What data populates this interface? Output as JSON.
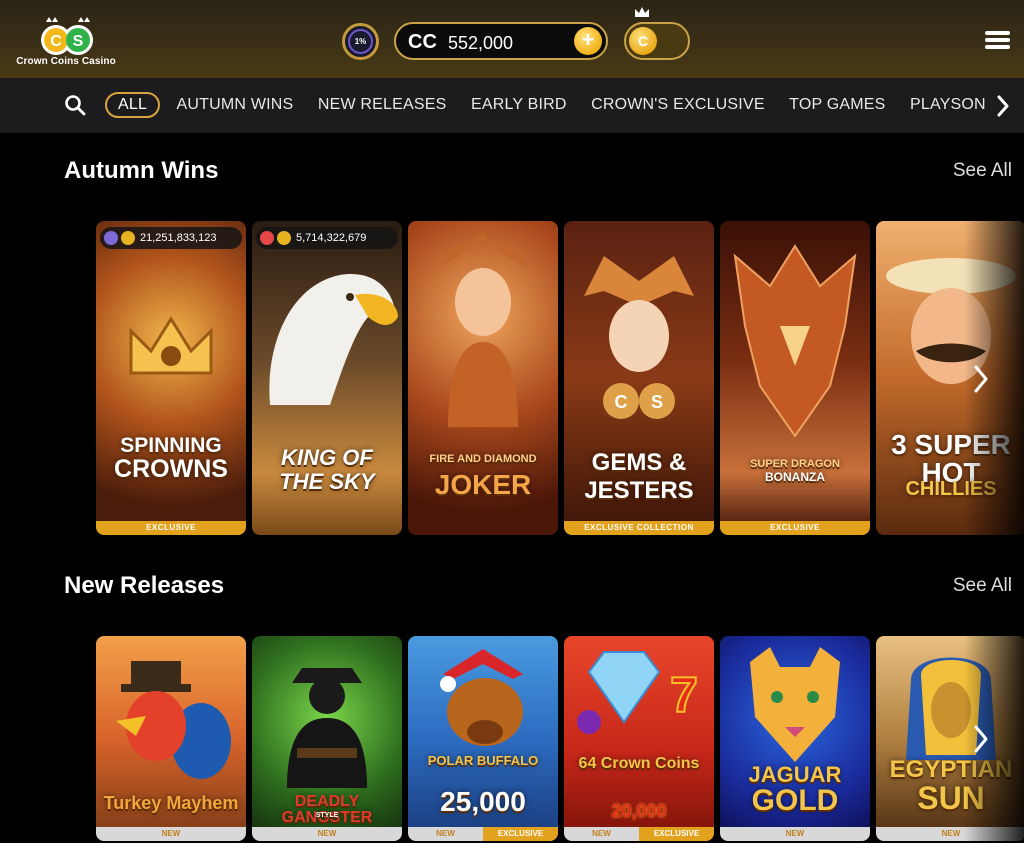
{
  "header": {
    "logo_text": "Crown Coins Casino",
    "vip_label": "1%",
    "balance_currency": "CC",
    "balance_amount": "552,000",
    "coin_letter": "C"
  },
  "nav": {
    "items": [
      "ALL",
      "AUTUMN WINS",
      "NEW RELEASES",
      "EARLY BIRD",
      "CROWN'S EXCLUSIVE",
      "TOP GAMES",
      "PLAYSON JACK"
    ]
  },
  "sections": [
    {
      "title": "Autumn Wins",
      "see_all": "See All",
      "tiles": [
        {
          "name_line1": "SPINNING",
          "name_line2": "CROWNS",
          "label": "EXCLUSIVE",
          "jackpot": "21,251,833,123"
        },
        {
          "name_line1": "KING OF",
          "name_line2": "THE SKY",
          "label": "",
          "jackpot": "5,714,322,679"
        },
        {
          "name_line1": "FIRE AND DIAMOND",
          "name_line2": "JOKER",
          "label": ""
        },
        {
          "name_line1": "GEMS &",
          "name_line2": "JESTERS",
          "label": "EXCLUSIVE COLLECTION"
        },
        {
          "name_line1": "SUPER DRAGON",
          "name_line2": "BONANZA",
          "label": "EXCLUSIVE"
        },
        {
          "name_line1": "3 SUPER HOT",
          "name_line2": "CHILLIES",
          "label": ""
        }
      ]
    },
    {
      "title": "New Releases",
      "see_all": "See All",
      "tiles": [
        {
          "name_line1": "Turkey Mayhem",
          "name_line2": "",
          "labels": [
            "NEW"
          ]
        },
        {
          "name_line1": "DEADLY GANGSTER",
          "name_line2": "STYLE",
          "labels": [
            "NEW"
          ]
        },
        {
          "name_line1": "POLAR BUFFALO",
          "name_line2": "25,000",
          "labels": [
            "NEW",
            "EXCLUSIVE"
          ]
        },
        {
          "name_line1": "64 Crown Coins",
          "name_line2": "20,000",
          "labels": [
            "NEW",
            "EXCLUSIVE"
          ]
        },
        {
          "name_line1": "JAGUAR",
          "name_line2": "GOLD",
          "labels": [
            "NEW"
          ]
        },
        {
          "name_line1": "EGYPTIAN",
          "name_line2": "SUN",
          "labels": [
            "NEW"
          ]
        }
      ]
    }
  ]
}
